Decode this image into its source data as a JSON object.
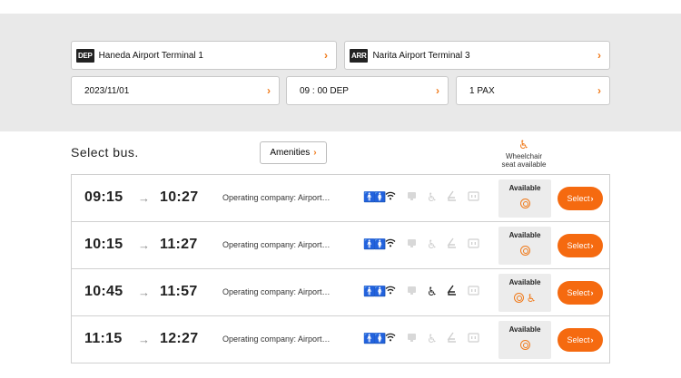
{
  "search": {
    "departure": {
      "tag": "DEP",
      "value": "Haneda Airport Terminal 1"
    },
    "arrival": {
      "tag": "ARR",
      "value": "Narita Airport Terminal 3"
    },
    "date": "2023/11/01",
    "time": "09 : 00 DEP",
    "pax": "1 PAX",
    "chevron": "›"
  },
  "results": {
    "title": "Select bus.",
    "amenities_label": "Amenities",
    "amenities_chevron": "›",
    "wheelchair_note_line1": "Wheelchair",
    "wheelchair_note_line2": "seat available"
  },
  "buses": [
    {
      "dep": "09:15",
      "arr": "10:27",
      "company": "Operating company: Airport…",
      "wheelchair_active": false,
      "seat_active": false,
      "availability": "Available",
      "wheelchair_seat": false,
      "select_label": "Select"
    },
    {
      "dep": "10:15",
      "arr": "11:27",
      "company": "Operating company: Airport…",
      "wheelchair_active": false,
      "seat_active": false,
      "availability": "Available",
      "wheelchair_seat": false,
      "select_label": "Select"
    },
    {
      "dep": "10:45",
      "arr": "11:57",
      "company": "Operating company: Airport…",
      "wheelchair_active": true,
      "seat_active": true,
      "availability": "Available",
      "wheelchair_seat": true,
      "select_label": "Select"
    },
    {
      "dep": "11:15",
      "arr": "12:27",
      "company": "Operating company: Airport…",
      "wheelchair_active": false,
      "seat_active": false,
      "availability": "Available",
      "wheelchair_seat": false,
      "select_label": "Select"
    }
  ],
  "icons": {
    "toilet": "toilet-icon",
    "wifi": "wifi-icon",
    "monitor": "monitor-icon",
    "wheelchair": "wheelchair-icon",
    "reclining_seat": "reclining-seat-icon",
    "power_outlet": "power-outlet-icon",
    "availability_mark": "double-circle-icon"
  },
  "colors": {
    "accent": "#f56a10",
    "panel": "#e9e9e9",
    "inactive_icon": "#cfcfcf"
  }
}
